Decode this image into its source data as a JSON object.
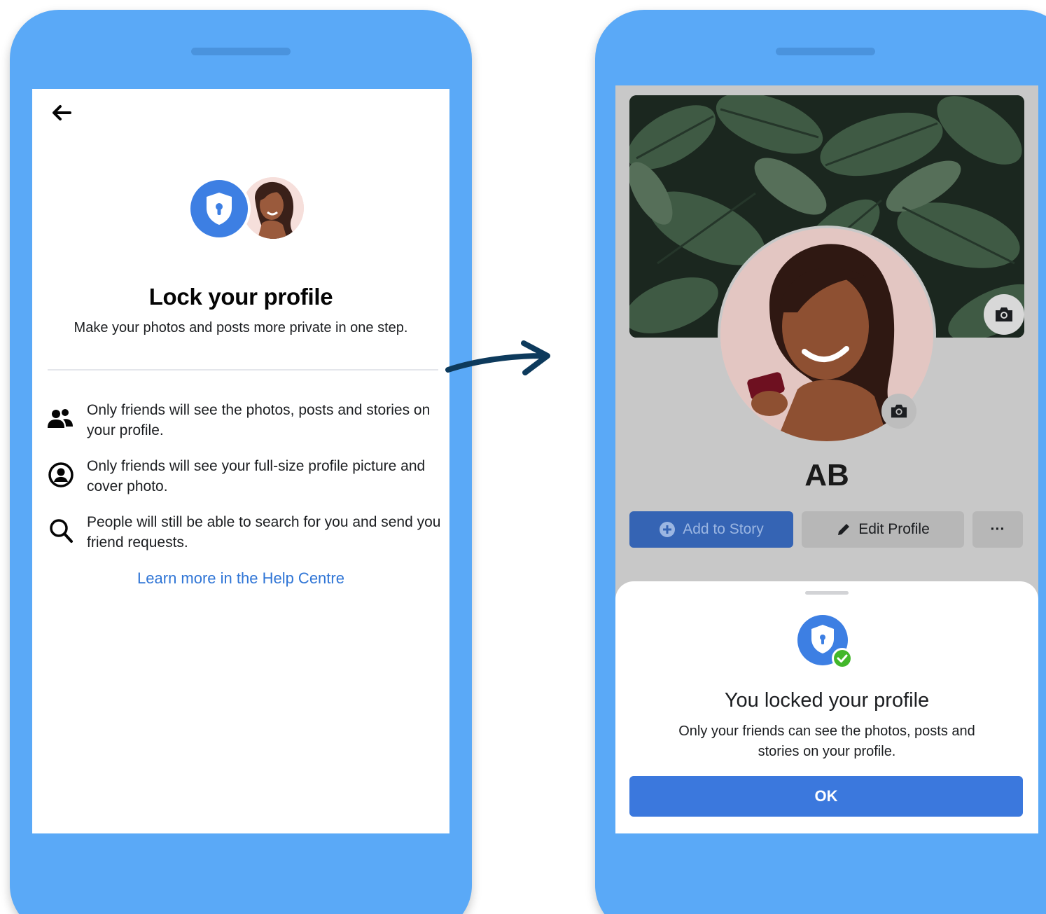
{
  "left_screen": {
    "title": "Lock your profile",
    "subtitle": "Make your photos and posts more private in one step.",
    "features": [
      {
        "icon": "friends-icon",
        "text": "Only friends will see the photos, posts and stories on your profile."
      },
      {
        "icon": "profile-circle-icon",
        "text": "Only friends will see your full-size profile picture and cover photo."
      },
      {
        "icon": "search-icon",
        "text": "People will still be able to search for you and send you friend requests."
      }
    ],
    "help_link": "Learn more in the Help Centre"
  },
  "right_screen": {
    "profile_name": "AB",
    "buttons": {
      "add_story": "Add to Story",
      "edit_profile": "Edit Profile",
      "more": "···"
    },
    "sheet": {
      "title": "You locked your profile",
      "text": "Only your friends can see the photos, posts and stories on your profile.",
      "ok": "OK"
    }
  },
  "colors": {
    "phone_body": "#5aa9f7",
    "facebook_blue": "#3d7fe3",
    "link_blue": "#2f75d6",
    "success_green": "#42b72a",
    "arrow": "#0d3a5c"
  }
}
